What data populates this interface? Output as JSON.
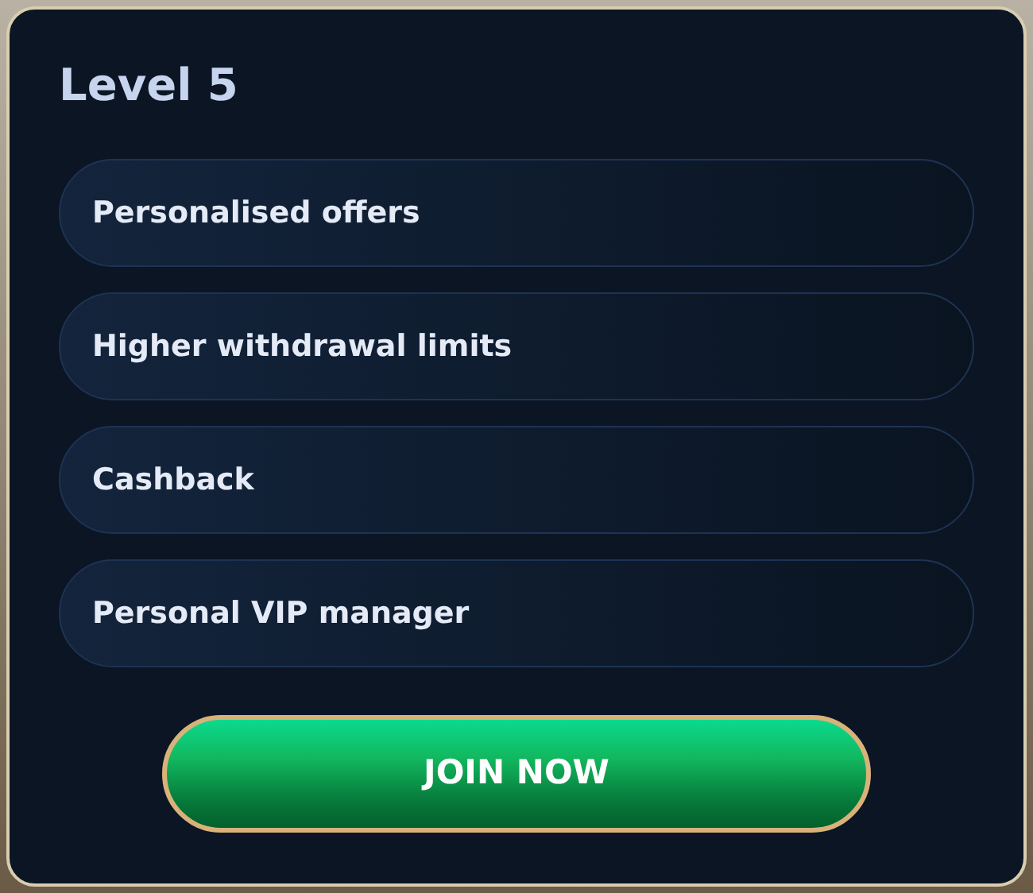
{
  "title": "Level 5",
  "benefits": [
    "Personalised offers",
    "Higher withdrawal limits",
    "Cashback",
    "Personal VIP manager"
  ],
  "button": "JOIN NOW"
}
